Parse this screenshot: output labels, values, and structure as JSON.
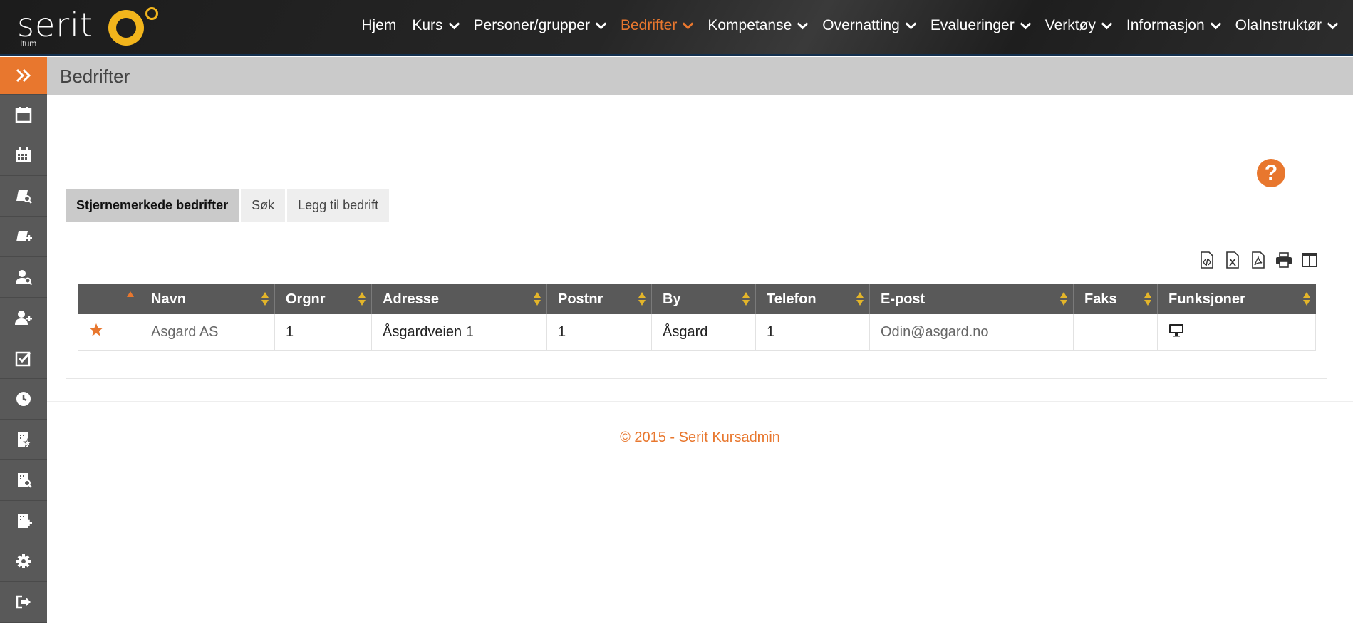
{
  "header": {
    "logo_text": "serit",
    "logo_sub": "Itum",
    "brand_color": "#e8772e",
    "nav": [
      {
        "label": "Hjem",
        "has_menu": false,
        "active": false
      },
      {
        "label": "Kurs",
        "has_menu": true,
        "active": false
      },
      {
        "label": "Personer/grupper",
        "has_menu": true,
        "active": false
      },
      {
        "label": "Bedrifter",
        "has_menu": true,
        "active": true
      },
      {
        "label": "Kompetanse",
        "has_menu": true,
        "active": false
      },
      {
        "label": "Overnatting",
        "has_menu": true,
        "active": false
      },
      {
        "label": "Evalueringer",
        "has_menu": true,
        "active": false
      },
      {
        "label": "Verktøy",
        "has_menu": true,
        "active": false
      },
      {
        "label": "Informasjon",
        "has_menu": true,
        "active": false
      },
      {
        "label": "OlaInstruktør",
        "has_menu": true,
        "active": false
      }
    ]
  },
  "sidebar": {
    "items": [
      "expand-icon",
      "calendar-icon",
      "calendar-grid-icon",
      "course-search-icon",
      "course-add-icon",
      "person-search-icon",
      "person-add-icon",
      "checkbox-icon",
      "clock-icon",
      "company-star-icon",
      "company-search-icon",
      "company-add-icon",
      "gear-icon",
      "logout-icon"
    ]
  },
  "page": {
    "title": "Bedrifter",
    "help_label": "?"
  },
  "tabs": [
    {
      "label": "Stjernemerkede bedrifter",
      "active": true
    },
    {
      "label": "Søk",
      "active": false
    },
    {
      "label": "Legg til bedrift",
      "active": false
    }
  ],
  "tools": [
    "export-csv-icon",
    "export-excel-icon",
    "export-pdf-icon",
    "print-icon",
    "columns-icon"
  ],
  "table": {
    "columns": [
      "",
      "Navn",
      "Orgnr",
      "Adresse",
      "Postnr",
      "By",
      "Telefon",
      "E-post",
      "Faks",
      "Funksjoner"
    ],
    "rows": [
      {
        "starred": true,
        "navn": "Asgard AS",
        "orgnr": "1",
        "adresse": "Åsgardveien 1",
        "postnr": "1",
        "by": "Åsgard",
        "telefon": "1",
        "epost": "Odin@asgard.no",
        "faks": "",
        "funksjoner": "monitor-icon"
      }
    ]
  },
  "footer": {
    "text": "© 2015 - Serit Kursadmin"
  }
}
